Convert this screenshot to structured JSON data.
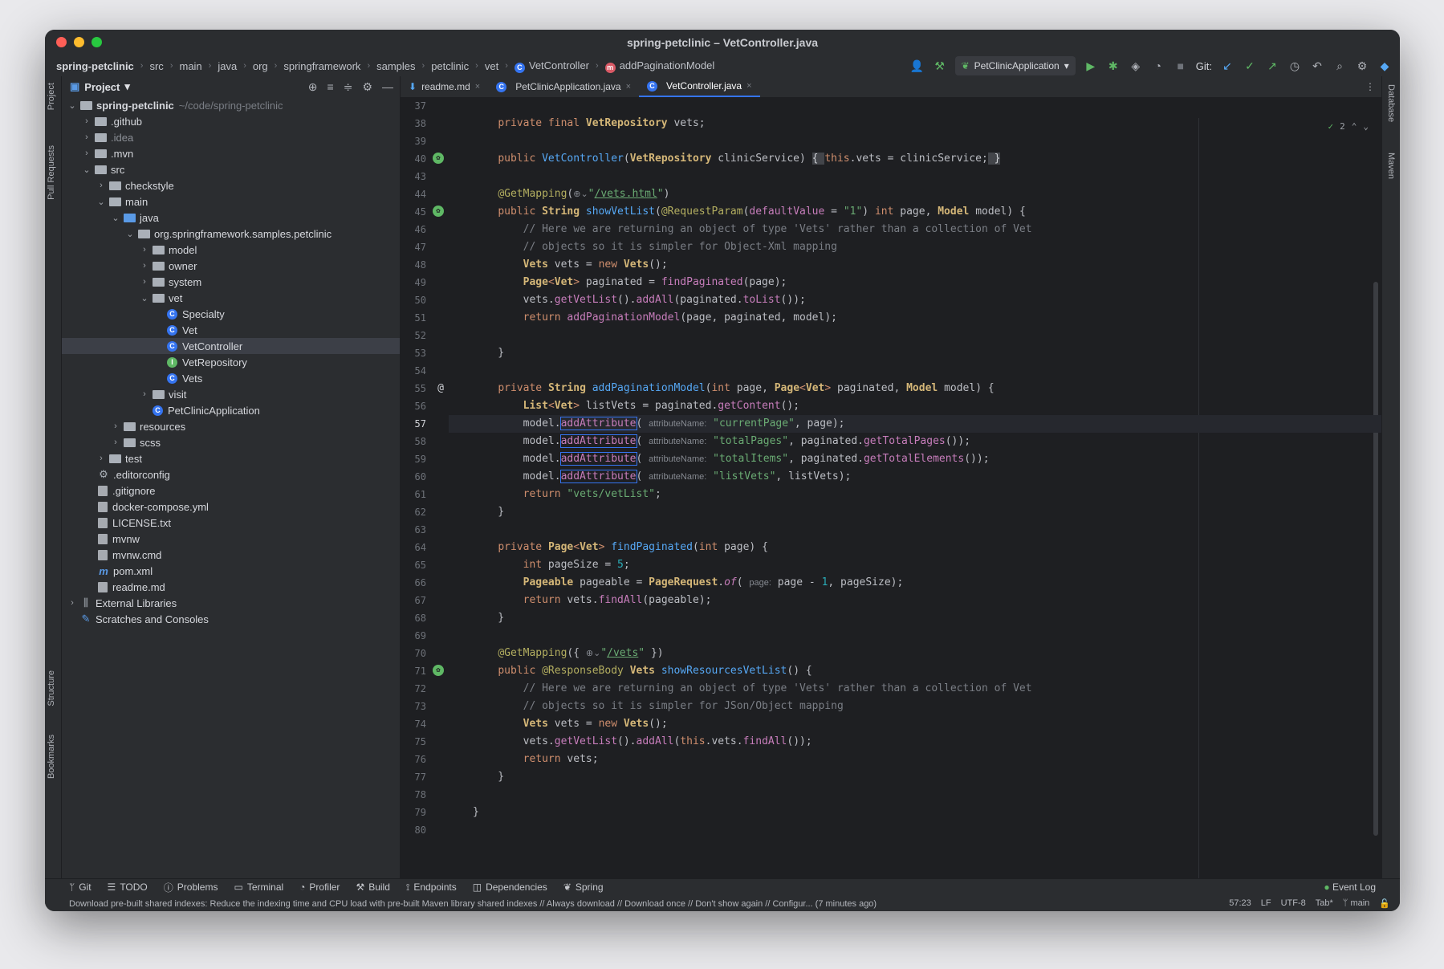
{
  "window": {
    "title": "spring-petclinic – VetController.java"
  },
  "breadcrumbs": [
    "spring-petclinic",
    "src",
    "main",
    "java",
    "org",
    "springframework",
    "samples",
    "petclinic",
    "vet",
    "VetController",
    "addPaginationModel"
  ],
  "toolbar": {
    "run_config": "PetClinicApplication",
    "git_label": "Git:"
  },
  "sidebar_left": {
    "project": "Project",
    "pull_requests": "Pull Requests",
    "structure": "Structure",
    "bookmarks": "Bookmarks"
  },
  "sidebar_right": {
    "database": "Database",
    "maven": "Maven"
  },
  "project": {
    "title": "Project",
    "root_name": "spring-petclinic",
    "root_path": "~/code/spring-petclinic",
    "items": {
      "github": ".github",
      "idea": ".idea",
      "mvn": ".mvn",
      "src": "src",
      "checkstyle": "checkstyle",
      "main": "main",
      "java": "java",
      "pkg": "org.springframework.samples.petclinic",
      "model": "model",
      "owner": "owner",
      "system": "system",
      "vet": "vet",
      "specialty": "Specialty",
      "vet_cls": "Vet",
      "vetcontroller": "VetController",
      "vetrepository": "VetRepository",
      "vets": "Vets",
      "visit": "visit",
      "petclinicapp": "PetClinicApplication",
      "resources": "resources",
      "scss": "scss",
      "test": "test",
      "editorconfig": ".editorconfig",
      "gitignore": ".gitignore",
      "dockercompose": "docker-compose.yml",
      "license": "LICENSE.txt",
      "mvnw": "mvnw",
      "mvnwcmd": "mvnw.cmd",
      "pom": "pom.xml",
      "readme": "readme.md",
      "extlibs": "External Libraries",
      "scratches": "Scratches and Consoles"
    }
  },
  "tabs": [
    "readme.md",
    "PetClinicApplication.java",
    "VetController.java"
  ],
  "editor": {
    "inspection_count": "2",
    "current_line": "57"
  },
  "line_numbers": [
    "37",
    "38",
    "39",
    "40",
    "43",
    "44",
    "45",
    "46",
    "47",
    "48",
    "49",
    "50",
    "51",
    "52",
    "53",
    "54",
    "55",
    "56",
    "57",
    "58",
    "59",
    "60",
    "61",
    "62",
    "63",
    "64",
    "65",
    "66",
    "67",
    "68",
    "69",
    "70",
    "71",
    "72",
    "73",
    "74",
    "75",
    "76",
    "77",
    "78",
    "79",
    "80"
  ],
  "code": {
    "l38_vets": "vets;",
    "l40_params": "clinicService)",
    "l40_body": ".vets = clinicService;",
    "l44_url": "/vets.html",
    "l45_default": "\"1\"",
    "l46": "// Here we are returning an object of type 'Vets' rather than a collection of Vet",
    "l47": "// objects so it is simpler for Object-Xml mapping",
    "l56_rest": "listVets = paginated.",
    "l57_str": "\"currentPage\"",
    "l58_str": "\"totalPages\"",
    "l59_str": "\"totalItems\"",
    "l60_str": "\"listVets\"",
    "l61_str": "\"vets/vetList\"",
    "l65_num": "5",
    "l70_url": "/vets",
    "l72": "// Here we are returning an object of type 'Vets' rather than a collection of Vet",
    "l73": "// objects so it is simpler for JSon/Object mapping",
    "hint_attr": "attributeName:",
    "hint_page": "page:"
  },
  "toolwindows": [
    "Git",
    "TODO",
    "Problems",
    "Terminal",
    "Profiler",
    "Build",
    "Endpoints",
    "Dependencies",
    "Spring"
  ],
  "status": {
    "event_log": "Event Log",
    "message": "Download pre-built shared indexes: Reduce the indexing time and CPU load with pre-built Maven library shared indexes // Always download // Download once // Don't show again // Configur... (7 minutes ago)",
    "position": "57:23",
    "line_sep": "LF",
    "encoding": "UTF-8",
    "indent": "Tab*",
    "branch": "main"
  }
}
